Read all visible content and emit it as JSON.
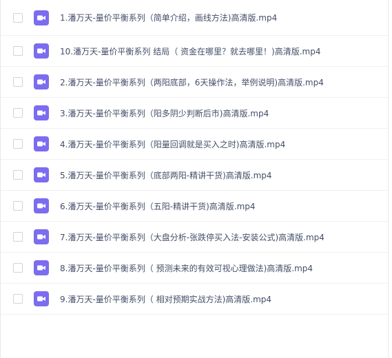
{
  "colors": {
    "icon_bg": "#7b6cf0",
    "text": "#424e67",
    "checkbox_border": "#d3d3d3"
  },
  "icon": "video-file-icon",
  "files": [
    {
      "name": "1.潘万天-量价平衡系列（简单介绍，画线方法)高清版.mp4"
    },
    {
      "name": "10.潘万天-量价平衡系列 结局（ 资金在哪里？就去哪里！)高清版.mp4"
    },
    {
      "name": "2.潘万天-量价平衡系列（两阳底部，6天操作法，举例说明)高清版.mp4"
    },
    {
      "name": "3.潘万天-量价平衡系列（阳多阴少判断后市)高清版.mp4"
    },
    {
      "name": "4.潘万天-量价平衡系列（阳量回调就是买入之时)高清版.mp4"
    },
    {
      "name": "5.潘万天-量价平衡系列（底部两阳-精讲干货)高清版.mp4"
    },
    {
      "name": "6.潘万天-量价平衡系列（五阳-精讲干货)高清版.mp4"
    },
    {
      "name": "7.潘万天-量价平衡系列（大盘分析-张跌停买入法-安装公式)高清版.mp4"
    },
    {
      "name": "8.潘万天-量价平衡系列（ 预测未来的有效可视心理做法)高清版.mp4"
    },
    {
      "name": "9.潘万天-量价平衡系列（ 相对预期实战方法)高清版.mp4"
    }
  ]
}
